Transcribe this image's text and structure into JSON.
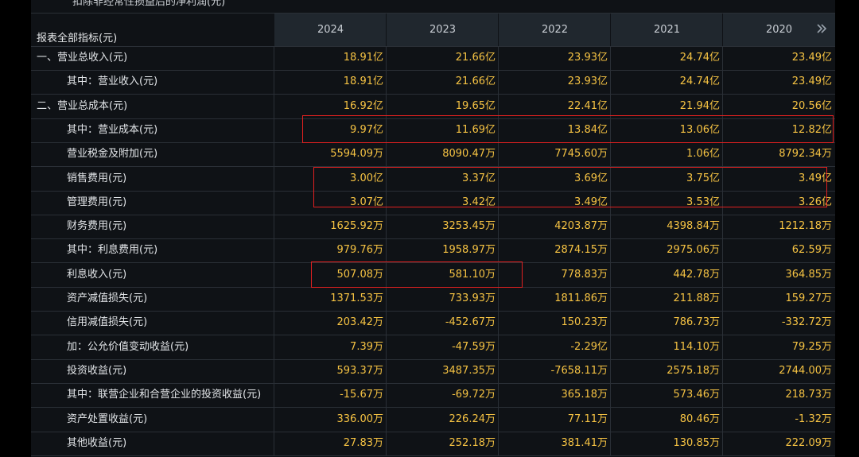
{
  "header": {
    "cut_title": "扣除非经常性损益后的净利润(元)",
    "label_column": "报表全部指标(元)",
    "years": [
      "2024",
      "2023",
      "2022",
      "2021",
      "2020"
    ],
    "expand_icon": "double-chevron-right-icon"
  },
  "rows": [
    {
      "label": "一、营业总收入(元)",
      "values": [
        "18.91亿",
        "21.66亿",
        "23.93亿",
        "24.74亿",
        "23.49亿"
      ]
    },
    {
      "label": "其中：营业收入(元)",
      "values": [
        "18.91亿",
        "21.66亿",
        "23.93亿",
        "24.74亿",
        "23.49亿"
      ]
    },
    {
      "label": "二、营业总成本(元)",
      "values": [
        "16.92亿",
        "19.65亿",
        "22.41亿",
        "21.94亿",
        "20.56亿"
      ]
    },
    {
      "label": "其中：营业成本(元)",
      "values": [
        "9.97亿",
        "11.69亿",
        "13.84亿",
        "13.06亿",
        "12.82亿"
      ]
    },
    {
      "label": "营业税金及附加(元)",
      "values": [
        "5594.09万",
        "8090.47万",
        "7745.60万",
        "1.06亿",
        "8792.34万"
      ]
    },
    {
      "label": "销售费用(元)",
      "values": [
        "3.00亿",
        "3.37亿",
        "3.69亿",
        "3.75亿",
        "3.49亿"
      ]
    },
    {
      "label": "管理费用(元)",
      "values": [
        "3.07亿",
        "3.42亿",
        "3.49亿",
        "3.53亿",
        "3.26亿"
      ]
    },
    {
      "label": "财务费用(元)",
      "values": [
        "1625.92万",
        "3253.45万",
        "4203.87万",
        "4398.84万",
        "1212.18万"
      ]
    },
    {
      "label": "其中：利息费用(元)",
      "values": [
        "979.76万",
        "1958.97万",
        "2874.15万",
        "2975.06万",
        "62.59万"
      ]
    },
    {
      "label": "利息收入(元)",
      "values": [
        "507.08万",
        "581.10万",
        "778.83万",
        "442.78万",
        "364.85万"
      ]
    },
    {
      "label": "资产减值损失(元)",
      "values": [
        "1371.53万",
        "733.93万",
        "1811.86万",
        "211.88万",
        "159.27万"
      ]
    },
    {
      "label": "信用减值损失(元)",
      "values": [
        "203.42万",
        "-452.67万",
        "150.23万",
        "786.73万",
        "-332.72万"
      ]
    },
    {
      "label": "加：公允价值变动收益(元)",
      "values": [
        "7.39万",
        "-47.59万",
        "-2.29亿",
        "114.10万",
        "79.25万"
      ]
    },
    {
      "label": "投资收益(元)",
      "values": [
        "593.37万",
        "3487.35万",
        "-7658.11万",
        "2575.18万",
        "2744.00万"
      ]
    },
    {
      "label": "其中：联营企业和合营企业的投资收益(元)",
      "values": [
        "-15.67万",
        "-69.72万",
        "365.18万",
        "573.46万",
        "218.73万"
      ]
    },
    {
      "label": "资产处置收益(元)",
      "values": [
        "336.00万",
        "226.24万",
        "77.11万",
        "80.46万",
        "-1.32万"
      ]
    },
    {
      "label": "其他收益(元)",
      "values": [
        "27.83万",
        "252.18万",
        "381.41万",
        "130.85万",
        "222.09万"
      ]
    }
  ],
  "colors": {
    "value_text": "#f6c343",
    "highlight_box": "#e02020",
    "header_bg": "#20272e",
    "page_bg": "#0f1216"
  }
}
